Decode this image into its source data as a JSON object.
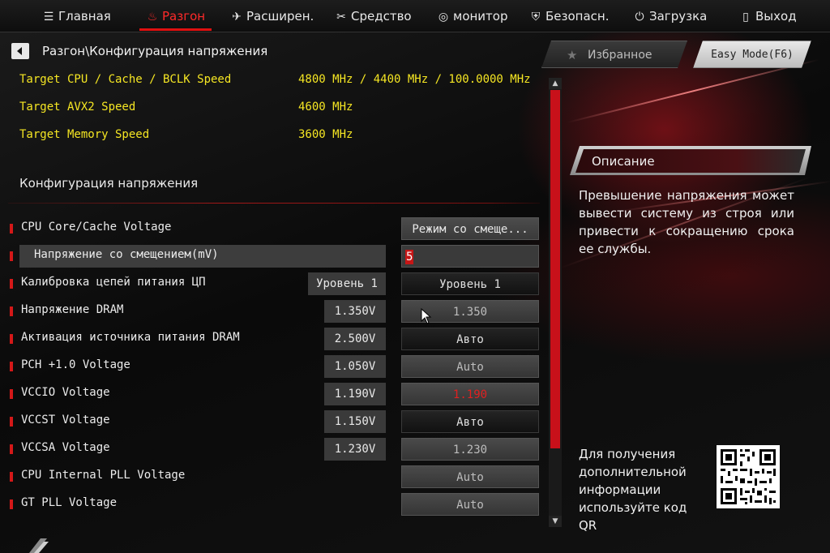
{
  "nav": {
    "items": [
      {
        "label": "Главная",
        "icon": "list-icon"
      },
      {
        "label": "Разгон",
        "icon": "flame-icon"
      },
      {
        "label": "Расширен.",
        "icon": "star-plane-icon"
      },
      {
        "label": "Средство",
        "icon": "tools-icon"
      },
      {
        "label": "монитор",
        "icon": "monitor-icon"
      },
      {
        "label": "Безопасн.",
        "icon": "shield-icon"
      },
      {
        "label": "Загрузка",
        "icon": "power-icon"
      },
      {
        "label": "Выход",
        "icon": "exit-door-icon"
      }
    ],
    "active": "Разгон",
    "accent_color": "#e01010"
  },
  "breadcrumb": "Разгон\\Конфигурация напряжения",
  "buttons": {
    "favorites": "Избранное",
    "easy_mode": "Easy Mode(F6)"
  },
  "targets": [
    {
      "label": "Target CPU / Cache / BCLK Speed",
      "value": "4800 MHz / 4400 MHz / 100.0000 MHz"
    },
    {
      "label": "Target AVX2 Speed",
      "value": "4600 MHz"
    },
    {
      "label": "Target Memory Speed",
      "value": "3600 MHz"
    }
  ],
  "section_title": "Конфигурация напряжения",
  "settings": [
    {
      "label": "CPU Core/Cache Voltage",
      "current": "",
      "control": "Режим со смеще..."
    },
    {
      "label": "Напряжение со смещением(mV)",
      "current": "",
      "control": "5"
    },
    {
      "label": "Калибровка цепей питания ЦП",
      "current": "Уровень 1",
      "control": "Уровень 1"
    },
    {
      "label": "Напряжение DRAM",
      "current": "1.350V",
      "control": "1.350"
    },
    {
      "label": "Активация источника питания DRAM",
      "current": "2.500V",
      "control": "Авто"
    },
    {
      "label": "PCH +1.0 Voltage",
      "current": "1.050V",
      "control": "Auto"
    },
    {
      "label": "VCCIO Voltage",
      "current": "1.190V",
      "control": "1.190"
    },
    {
      "label": "VCCST Voltage",
      "current": "1.150V",
      "control": "Авто"
    },
    {
      "label": "VCCSA Voltage",
      "current": "1.230V",
      "control": "1.230"
    },
    {
      "label": "CPU Internal PLL Voltage",
      "current": "",
      "control": "Auto"
    },
    {
      "label": "GT PLL Voltage",
      "current": "",
      "control": "Auto"
    }
  ],
  "description": {
    "title": "Описание",
    "text": "Превышение напряжения может вывести систему из строя или привести к сокращению срока ее службы."
  },
  "qr_info": "Для получения дополнительной информации используйте код QR",
  "colors": {
    "target_text": "#f5e623",
    "marker": "#d41818",
    "modified_value": "#e02020"
  }
}
